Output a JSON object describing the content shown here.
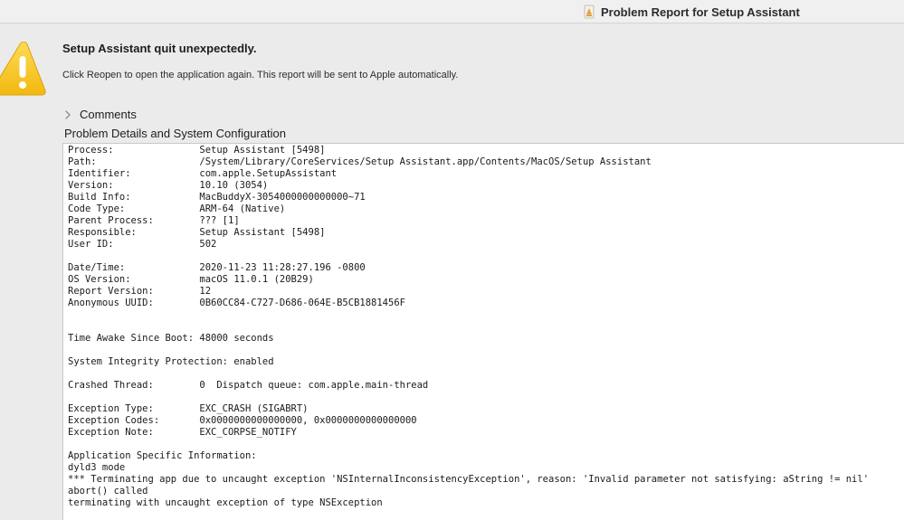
{
  "window": {
    "title": "Problem Report for Setup Assistant",
    "icon": "setup-assistant-app-icon"
  },
  "alert": {
    "icon": "warning-triangle-icon",
    "accent_color": "#f7c51f",
    "headline": "Setup Assistant quit unexpectedly.",
    "message": "Click Reopen to open the application again. This report will be sent to Apple automatically."
  },
  "comments": {
    "label": "Comments",
    "state": "collapsed"
  },
  "details": {
    "label": "Problem Details and System Configuration",
    "report_lines": [
      "Process:               Setup Assistant [5498]",
      "Path:                  /System/Library/CoreServices/Setup Assistant.app/Contents/MacOS/Setup Assistant",
      "Identifier:            com.apple.SetupAssistant",
      "Version:               10.10 (3054)",
      "Build Info:            MacBuddyX-3054000000000000~71",
      "Code Type:             ARM-64 (Native)",
      "Parent Process:        ??? [1]",
      "Responsible:           Setup Assistant [5498]",
      "User ID:               502",
      "",
      "Date/Time:             2020-11-23 11:28:27.196 -0800",
      "OS Version:            macOS 11.0.1 (20B29)",
      "Report Version:        12",
      "Anonymous UUID:        0B60CC84-C727-D686-064E-B5CB1881456F",
      "",
      "",
      "Time Awake Since Boot: 48000 seconds",
      "",
      "System Integrity Protection: enabled",
      "",
      "Crashed Thread:        0  Dispatch queue: com.apple.main-thread",
      "",
      "Exception Type:        EXC_CRASH (SIGABRT)",
      "Exception Codes:       0x0000000000000000, 0x0000000000000000",
      "Exception Note:        EXC_CORPSE_NOTIFY",
      "",
      "Application Specific Information:",
      "dyld3 mode",
      "*** Terminating app due to uncaught exception 'NSInternalInconsistencyException', reason: 'Invalid parameter not satisfying: aString != nil'",
      "abort() called",
      "terminating with uncaught exception of type NSException"
    ]
  }
}
